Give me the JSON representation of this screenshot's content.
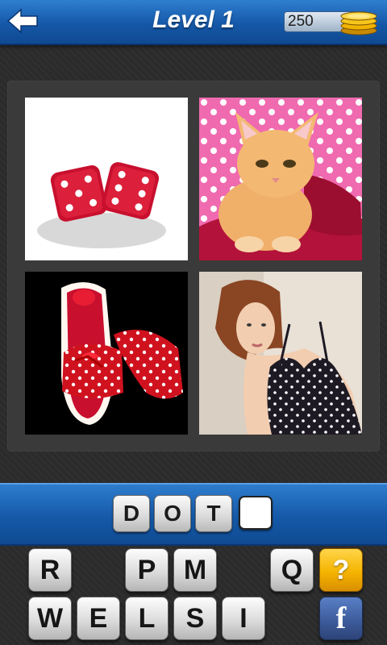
{
  "header": {
    "title": "Level 1",
    "coins": "250",
    "back_icon": "arrow-left-icon",
    "coin_icon": "gold-coins-icon"
  },
  "photos": [
    {
      "name": "red-dice"
    },
    {
      "name": "kitten-polka-dot"
    },
    {
      "name": "polka-dot-shoes"
    },
    {
      "name": "woman-polka-dot-dress"
    }
  ],
  "answer": {
    "letters": [
      "D",
      "O",
      "T",
      ""
    ]
  },
  "keyboard": {
    "row1": [
      "R",
      "P",
      "M",
      "Q"
    ],
    "row2": [
      "W",
      "E",
      "L",
      "S",
      "I"
    ],
    "hint_label": "?",
    "facebook_label": "f"
  },
  "colors": {
    "accent_blue": "#1559a8",
    "hint_yellow": "#f5b400",
    "facebook_blue": "#3b5998"
  }
}
